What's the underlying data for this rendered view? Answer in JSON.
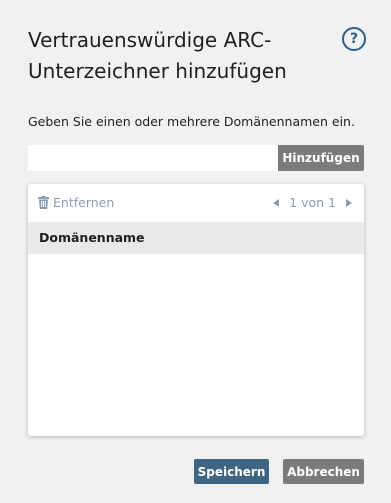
{
  "dialog": {
    "title": "Vertrauenswürdige ARC-Unterzeichner hinzufügen",
    "help_icon": "question-circle-icon",
    "help_glyph": "?",
    "instruction": "Geben Sie einen oder mehrere Domänennamen ein."
  },
  "input": {
    "value": "",
    "placeholder": ""
  },
  "add_button": {
    "label": "Hinzufügen"
  },
  "list": {
    "remove_label": "Entfernen",
    "remove_icon": "trash-icon",
    "pager_text": "1 von 1",
    "column_header": "Domänenname",
    "rows": []
  },
  "footer": {
    "save_label": "Speichern",
    "cancel_label": "Abbrechen"
  },
  "colors": {
    "background": "#f1f1f1",
    "accent": "#3e6683",
    "help_icon": "#2a5f91",
    "muted_link": "#8a9db5",
    "secondary_button": "#7b7b7b"
  }
}
